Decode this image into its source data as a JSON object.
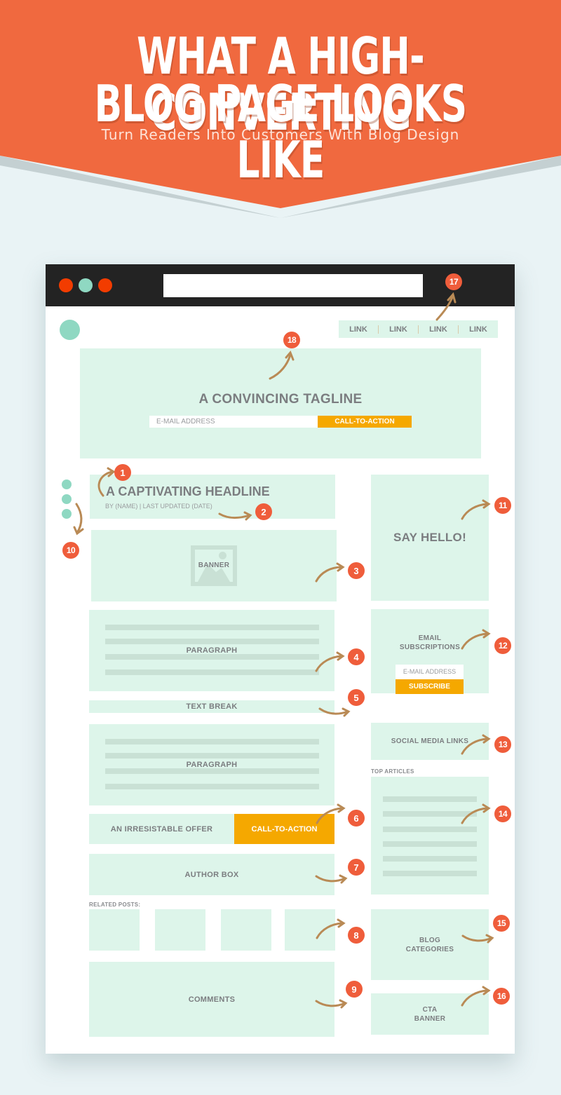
{
  "header": {
    "title_line1": "WHAT A HIGH-CONVERTING",
    "title_line2": "BLOG PAGE LOOKS LIKE",
    "subtitle": "Turn Readers Into Customers With Blog Design"
  },
  "colors": {
    "orange": "#f0693f",
    "badge": "#ef5d3b",
    "mint": "#ddf5ea",
    "cta": "#f5a800",
    "arrow": "#b98a55",
    "dark_bar": "#232323",
    "teal_dot": "#8fd8c2",
    "red_dot": "#f23c00",
    "background": "#e9f3f5"
  },
  "browser": {
    "window_dots": [
      "red-dot",
      "teal-dot",
      "red-dot"
    ],
    "url": ""
  },
  "nav": {
    "links": [
      "LINK",
      "LINK",
      "LINK",
      "LINK"
    ]
  },
  "hero": {
    "tagline": "A CONVINCING TAGLINE",
    "email_placeholder": "E-MAIL ADDRESS",
    "cta_label": "CALL-TO-ACTION"
  },
  "post": {
    "headline": "A CAPTIVATING HEADLINE",
    "byline": "BY (NAME) | LAST UPDATED (DATE)",
    "banner_label": "BANNER",
    "paragraph1_label": "PARAGRAPH",
    "text_break_label": "TEXT BREAK",
    "paragraph2_label": "PARAGRAPH",
    "offer_label": "AN IRRESISTABLE OFFER",
    "offer_cta_label": "CALL-TO-ACTION",
    "author_box_label": "AUTHOR BOX",
    "related_posts_label": "RELATED POSTS:",
    "related_posts_count": 4,
    "comments_label": "COMMENTS"
  },
  "sidebar": {
    "say_hello": "SAY HELLO!",
    "email_sub_line1": "EMAIL",
    "email_sub_line2": "SUBSCRIPTIONS",
    "email_placeholder": "E-MAIL ADDRESS",
    "subscribe_label": "SUBSCRIBE",
    "social_links": "SOCIAL MEDIA LINKS",
    "top_articles": "TOP ARTICLES",
    "blog_categories_line1": "BLOG",
    "blog_categories_line2": "CATEGORIES",
    "cta_banner_line1": "CTA",
    "cta_banner_line2": "BANNER"
  },
  "badges": [
    "1",
    "2",
    "3",
    "4",
    "5",
    "6",
    "7",
    "8",
    "9",
    "10",
    "11",
    "12",
    "13",
    "14",
    "15",
    "16",
    "17",
    "18"
  ]
}
